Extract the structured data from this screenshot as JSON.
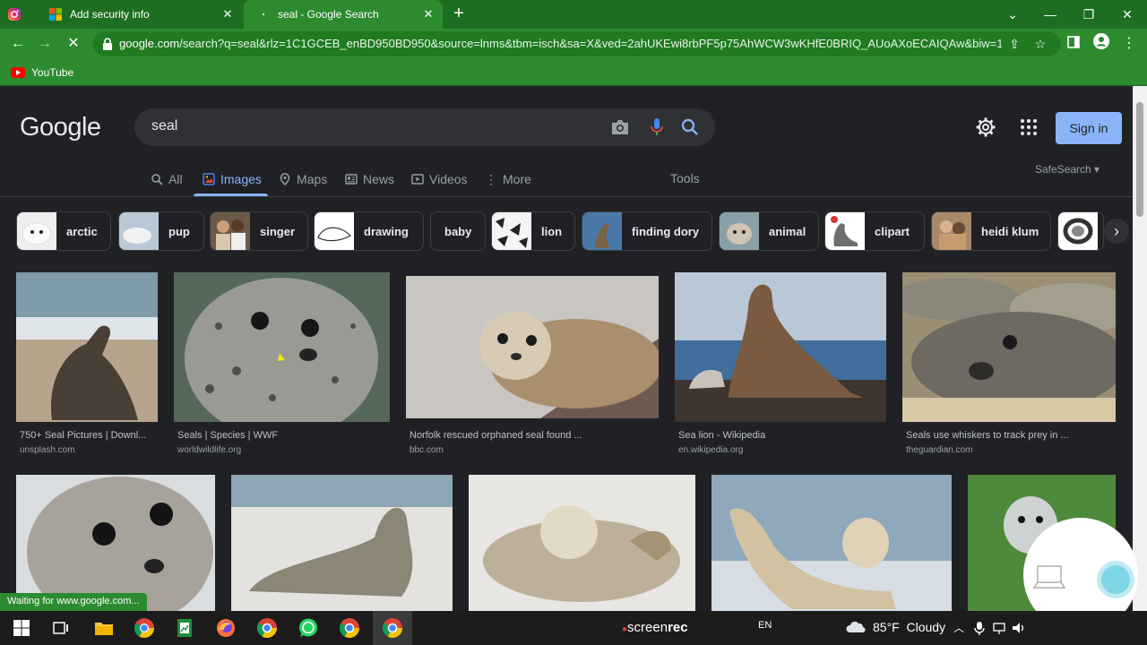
{
  "browser": {
    "tabs": [
      {
        "title": "",
        "icon": "instagram-icon"
      },
      {
        "title": "Add security info",
        "icon": "microsoft-icon"
      },
      {
        "title": "seal - Google Search",
        "icon": "loading-icon"
      }
    ],
    "url_host": "google.com",
    "url_rest": "/search?q=seal&rlz=1C1GCEB_enBD950BD950&source=lnms&tbm=isch&sa=X&ved=2ahUKEwi8rbPF5p75AhWCW3wKHfE0BRIQ_AUoAXoECAIQAw&biw=1...",
    "bookmarks": [
      {
        "label": "YouTube",
        "icon": "youtube-icon"
      }
    ],
    "theme_color": "#2c8b2f"
  },
  "google": {
    "logo": "Google",
    "query": "seal",
    "sign_in": "Sign in",
    "nav": {
      "all": "All",
      "images": "Images",
      "maps": "Maps",
      "news": "News",
      "videos": "Videos",
      "more": "More",
      "tools": "Tools"
    },
    "safesearch": "SafeSearch",
    "chips": [
      "arctic",
      "pup",
      "singer",
      "drawing",
      "baby",
      "lion",
      "finding dory",
      "animal",
      "clipart",
      "heidi klum"
    ],
    "results_row1": [
      {
        "title": "750+ Seal Pictures | Downl...",
        "source": "unsplash.com"
      },
      {
        "title": "Seals | Species | WWF",
        "source": "worldwildlife.org"
      },
      {
        "title": "Norfolk rescued orphaned seal found ...",
        "source": "bbc.com"
      },
      {
        "title": "Sea lion - Wikipedia",
        "source": "en.wikipedia.org"
      },
      {
        "title": "Seals use whiskers to track prey in ...",
        "source": "theguardian.com"
      }
    ],
    "status": "Waiting for www.google.com..."
  },
  "taskbar": {
    "screenrec_a": "screen",
    "screenrec_b": "rec",
    "lang": "EN",
    "temp": "85°F",
    "weather": "Cloudy"
  }
}
